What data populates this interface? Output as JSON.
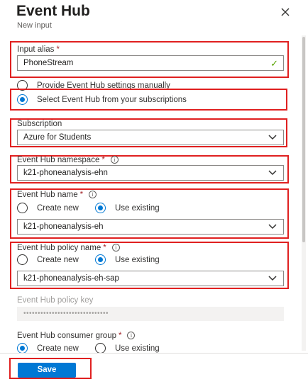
{
  "header": {
    "title": "Event Hub",
    "subtitle": "New input",
    "close_icon": "close-icon"
  },
  "input_alias": {
    "label": "Input alias",
    "required_mark": "*",
    "value": "PhoneStream",
    "status_icon": "checkmark-icon"
  },
  "source_options": [
    {
      "label": "Provide Event Hub settings manually",
      "selected": false
    },
    {
      "label": "Select Event Hub from your subscriptions",
      "selected": true
    }
  ],
  "subscription": {
    "label": "Subscription",
    "value": "Azure for Students"
  },
  "namespace": {
    "label": "Event Hub namespace",
    "required_mark": "*",
    "info_icon": "i",
    "value": "k21-phoneanalysis-ehn"
  },
  "hub_name": {
    "label": "Event Hub name",
    "required_mark": "*",
    "info_icon": "i",
    "options": [
      {
        "label": "Create new",
        "selected": false
      },
      {
        "label": "Use existing",
        "selected": true
      }
    ],
    "value": "k21-phoneanalysis-eh"
  },
  "policy_name": {
    "label": "Event Hub policy name",
    "required_mark": "*",
    "info_icon": "i",
    "options": [
      {
        "label": "Create new",
        "selected": false
      },
      {
        "label": "Use existing",
        "selected": true
      }
    ],
    "value": "k21-phoneanalysis-eh-sap"
  },
  "policy_key": {
    "label": "Event Hub policy key",
    "value": "••••••••••••••••••••••••••••••"
  },
  "consumer_group": {
    "label": "Event Hub consumer group",
    "required_mark": "*",
    "info_icon": "i",
    "options": [
      {
        "label": "Create new",
        "selected": true
      },
      {
        "label": "Use existing",
        "selected": false
      }
    ]
  },
  "footer": {
    "save_label": "Save"
  },
  "colors": {
    "accent": "#0078d4",
    "highlight_box": "#e02020",
    "valid": "#57a300",
    "required": "#a4262c"
  }
}
